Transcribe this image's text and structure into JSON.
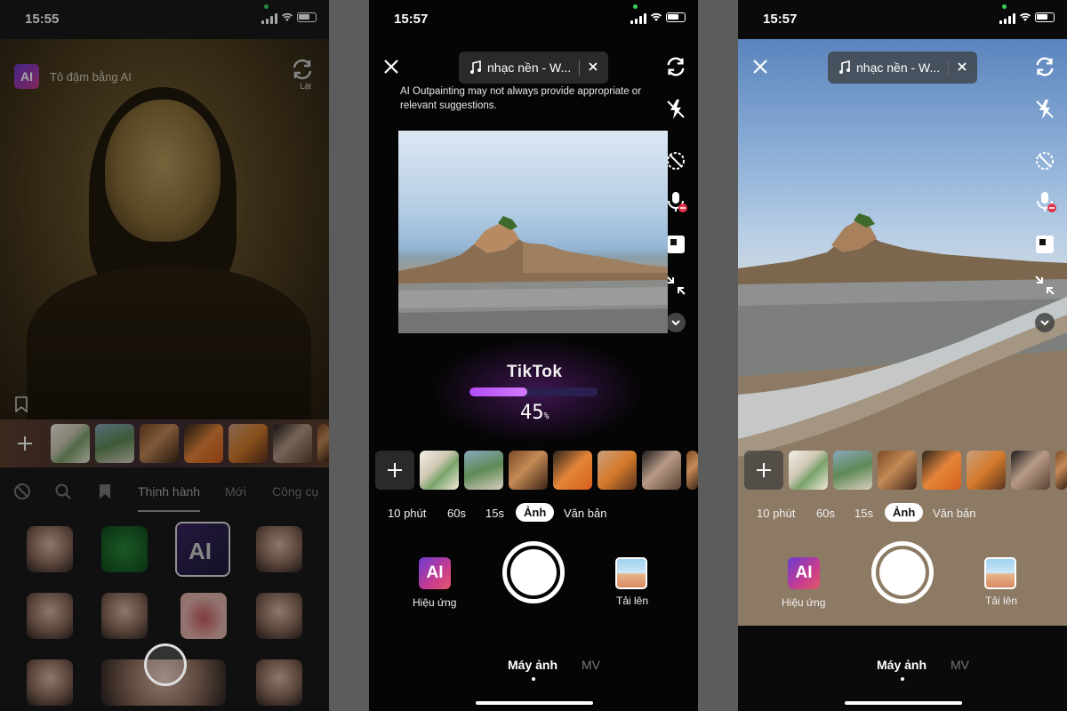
{
  "status": {
    "time1": "15:55",
    "time2": "15:57",
    "time3": "15:57"
  },
  "panel1": {
    "effect_name": "Tô đậm bằng AI",
    "ai_logo": "AI",
    "flip_label": "Lật",
    "tabs": [
      "Thịnh hành",
      "Mới",
      "Công cụ"
    ],
    "grid_ai_label": "AI"
  },
  "panel2": {
    "music_label": "nhạc nền - W...",
    "notice": "AI Outpainting may not always provide appropriate or relevant suggestions.",
    "progress_word": "TikTok",
    "progress_value": 45,
    "progress_text": "45",
    "progress_unit": "%"
  },
  "panel3": {
    "music_label": "nhạc nền - W..."
  },
  "common": {
    "modes": [
      "10 phút",
      "60s",
      "15s",
      "Ảnh",
      "Văn bản"
    ],
    "active_mode": "Ảnh",
    "effect_label": "Hiệu ứng",
    "effect_icon_text": "AI",
    "upload_label": "Tải lên",
    "nav_camera": "Máy ảnh",
    "nav_mv": "MV"
  },
  "icons": {
    "close": "close-icon",
    "music": "music-note-icon",
    "flip": "flip-camera-icon",
    "flash": "flash-off-icon",
    "timer": "timer-icon",
    "mic": "mic-off-icon",
    "ratio": "aspect-ratio-icon",
    "collapse": "collapse-icon",
    "more": "chevron-down-icon",
    "add": "plus-icon",
    "bookmark": "bookmark-icon",
    "search": "search-icon",
    "block": "no-effect-icon"
  },
  "colors": {
    "progress": "#c061fa",
    "accent": "#ffffff",
    "inactive": "#777777"
  }
}
